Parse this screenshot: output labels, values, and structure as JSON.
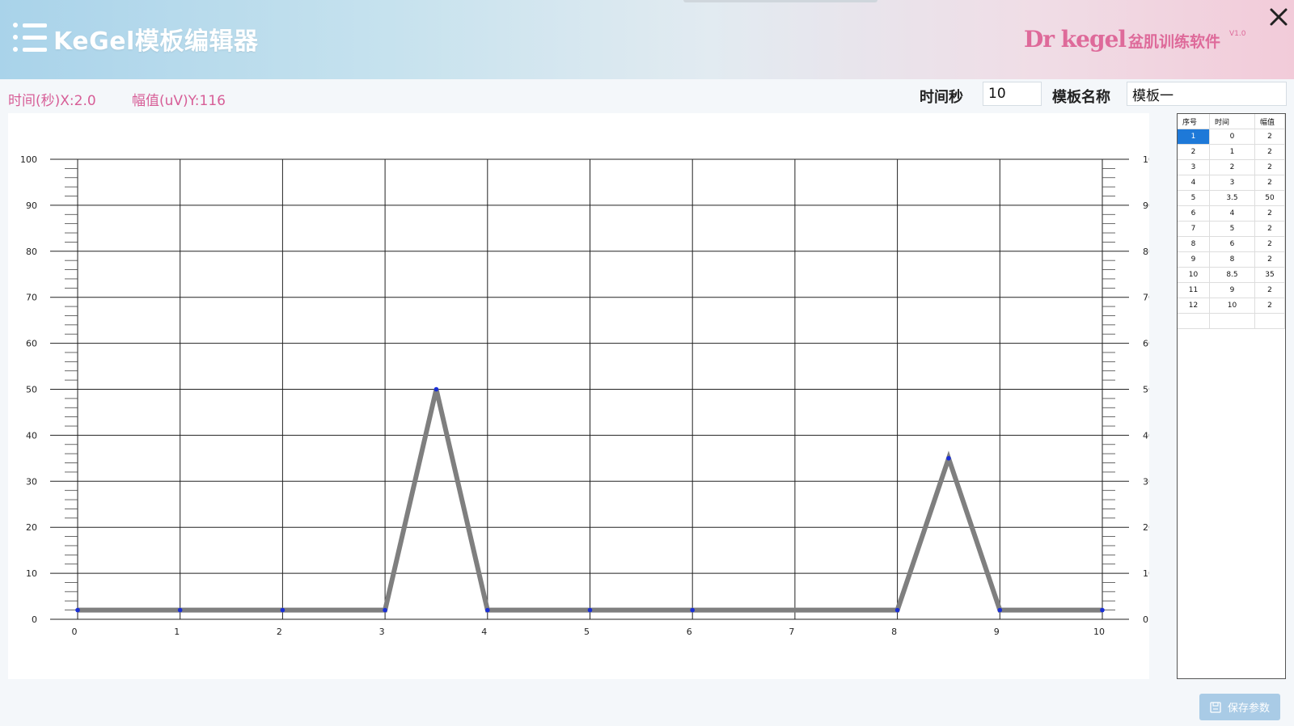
{
  "header": {
    "title": "KeGel模板编辑器",
    "brand_logo": "Dr kegel",
    "brand_subtitle": "盆肌训练软件",
    "version": "V1.0",
    "menu_icon": "menu-icon",
    "close_icon": "close-icon"
  },
  "toolbar": {
    "x_readout": "时间(秒)X:2.0",
    "y_readout": "幅值(uV)Y:116",
    "time_label": "时间秒",
    "time_value": "10",
    "name_label": "模板名称",
    "name_value": "模板一"
  },
  "table": {
    "headers": [
      "序号",
      "时间",
      "幅值"
    ],
    "rows": [
      [
        "1",
        "0",
        "2"
      ],
      [
        "2",
        "1",
        "2"
      ],
      [
        "3",
        "2",
        "2"
      ],
      [
        "4",
        "3",
        "2"
      ],
      [
        "5",
        "3.5",
        "50"
      ],
      [
        "6",
        "4",
        "2"
      ],
      [
        "7",
        "5",
        "2"
      ],
      [
        "8",
        "6",
        "2"
      ],
      [
        "9",
        "8",
        "2"
      ],
      [
        "10",
        "8.5",
        "35"
      ],
      [
        "11",
        "9",
        "2"
      ],
      [
        "12",
        "10",
        "2"
      ]
    ],
    "selected_row": 0
  },
  "actions": {
    "save_label": "保存参数",
    "save_icon": "save-icon"
  },
  "colors": {
    "accent_pink": "#de6a9a",
    "line": "#7f7f7f",
    "point": "#1a2fd6",
    "selected": "#1e79d8"
  },
  "chart_data": {
    "type": "line",
    "x": [
      0,
      1,
      2,
      3,
      3.5,
      4,
      5,
      6,
      8,
      8.5,
      9,
      10
    ],
    "series": [
      {
        "values": [
          2,
          2,
          2,
          2,
          50,
          2,
          2,
          2,
          2,
          35,
          2,
          2
        ]
      }
    ],
    "xlim": [
      0,
      10
    ],
    "ylim": [
      0,
      100
    ],
    "x_ticks": [
      "0",
      "1",
      "2",
      "3",
      "4",
      "5",
      "6",
      "7",
      "8",
      "9",
      "10"
    ],
    "y_ticks": [
      "0",
      "10",
      "20",
      "30",
      "40",
      "50",
      "60",
      "70",
      "80",
      "90",
      "100"
    ],
    "grid": true,
    "title": "",
    "xlabel": "",
    "ylabel": ""
  }
}
